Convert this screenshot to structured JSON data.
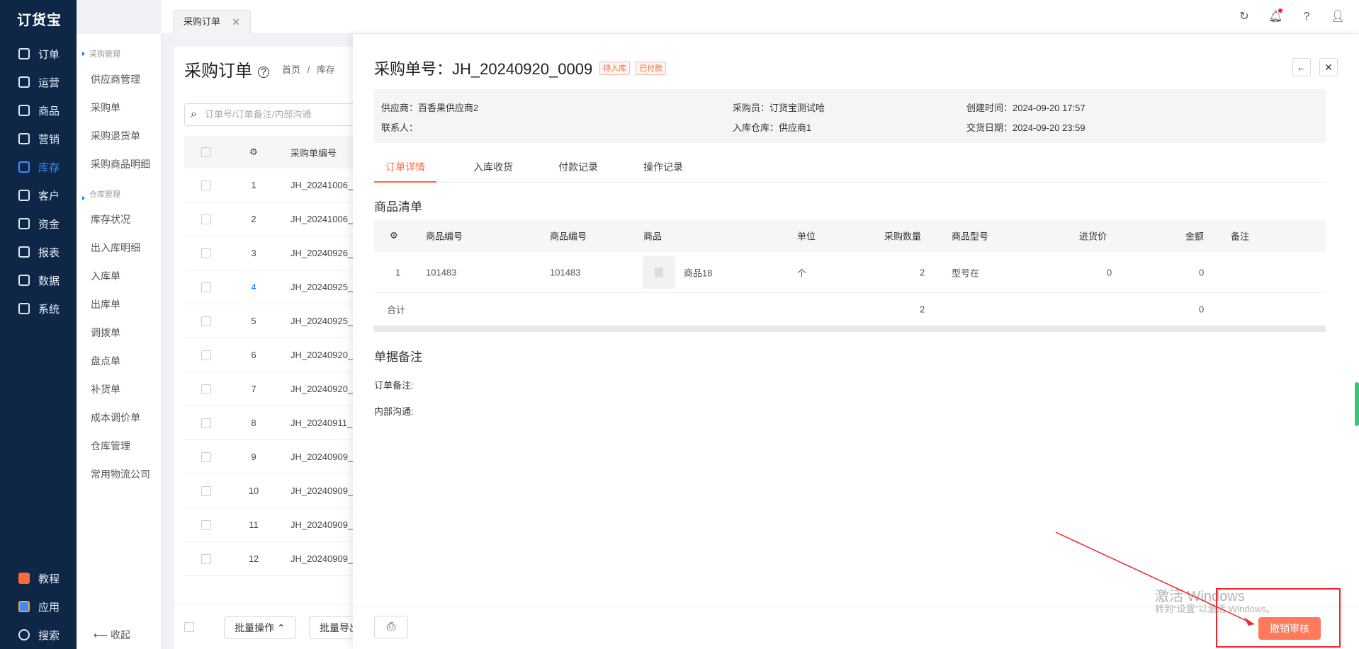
{
  "app": {
    "logo": "订货宝"
  },
  "nav": {
    "items": [
      {
        "label": "订单",
        "icon": "order-icon"
      },
      {
        "label": "运营",
        "icon": "operation-icon"
      },
      {
        "label": "商品",
        "icon": "goods-icon"
      },
      {
        "label": "营销",
        "icon": "marketing-icon"
      },
      {
        "label": "库存",
        "icon": "inventory-icon",
        "active": true
      },
      {
        "label": "客户",
        "icon": "customer-icon"
      },
      {
        "label": "资金",
        "icon": "fund-icon"
      },
      {
        "label": "报表",
        "icon": "report-icon"
      },
      {
        "label": "数据",
        "icon": "data-icon"
      },
      {
        "label": "系统",
        "icon": "system-icon"
      }
    ],
    "bottom": [
      {
        "label": "教程",
        "icon": "tutorial-icon"
      },
      {
        "label": "应用",
        "icon": "apps-icon"
      },
      {
        "label": "搜索",
        "icon": "search-icon"
      }
    ]
  },
  "submenu": {
    "group1": "采购管理",
    "group1_items": [
      "供应商管理",
      "采购单",
      "采购退货单",
      "采购商品明细"
    ],
    "group2": "仓库管理",
    "group2_items": [
      "库存状况",
      "出入库明细",
      "入库单",
      "出库单",
      "调拨单",
      "盘点单",
      "补货单",
      "成本调价单",
      "仓库管理",
      "常用物流公司"
    ],
    "collapse": "收起"
  },
  "topbar": {
    "tab_label": "采购订单",
    "icons": [
      "refresh-icon",
      "bell-icon",
      "help-icon",
      "user-icon"
    ]
  },
  "listpage": {
    "title": "采购订单",
    "crumb_home": "首页",
    "crumb_sep": "/",
    "crumb_current": "库存",
    "search_placeholder": "订单号/订单备注/内部沟通",
    "col_code": "采购单编号",
    "rows": [
      {
        "n": "1",
        "code": "JH_20241006_"
      },
      {
        "n": "2",
        "code": "JH_20241006_"
      },
      {
        "n": "3",
        "code": "JH_20240926_"
      },
      {
        "n": "4",
        "code": "JH_20240925_"
      },
      {
        "n": "5",
        "code": "JH_20240925_"
      },
      {
        "n": "6",
        "code": "JH_20240920_"
      },
      {
        "n": "7",
        "code": "JH_20240920_"
      },
      {
        "n": "8",
        "code": "JH_20240911_"
      },
      {
        "n": "9",
        "code": "JH_20240909_"
      },
      {
        "n": "10",
        "code": "JH_20240909_"
      },
      {
        "n": "11",
        "code": "JH_20240909_"
      },
      {
        "n": "12",
        "code": "JH_20240909_"
      }
    ],
    "batch_ops": "批量操作",
    "batch_export": "批量导出"
  },
  "drawer": {
    "title": "采购单号：JH_20240920_0009",
    "tag1": "待入库",
    "tag2": "已付款",
    "back_label": "←",
    "close_label": "✕",
    "info": {
      "supplier": "供应商：百香果供应商2",
      "contact": "联系人：",
      "buyer": "采购员：订货宝测试哈",
      "warehouse": "入库仓库：供应商1",
      "created": "创建时间：2024-09-20 17:57",
      "delivery": "交货日期：2024-09-20 23:59"
    },
    "tabs": [
      "订单详情",
      "入库收货",
      "付款记录",
      "操作记录"
    ],
    "goods_title": "商品清单",
    "goods_headers": [
      "商品编号",
      "商品编号",
      "商品",
      "单位",
      "采购数量",
      "商品型号",
      "进货价",
      "金额",
      "备注"
    ],
    "goods_rows": [
      {
        "idx": "1",
        "code1": "101483",
        "code2": "101483",
        "name": "商品18",
        "unit": "个",
        "qty": "2",
        "model": "型号在",
        "price": "0",
        "amount": "0",
        "remark": ""
      }
    ],
    "total_label": "合计",
    "total_qty": "2",
    "total_amount": "0",
    "remark_title": "单据备注",
    "order_remark": "订单备注:",
    "internal_comm": "内部沟通:",
    "print_icon": "printer-icon",
    "revoke_label": "撤销审核"
  },
  "watermark": {
    "line1": "激活 Windows",
    "line2": "转到\"设置\"以激活 Windows。"
  }
}
